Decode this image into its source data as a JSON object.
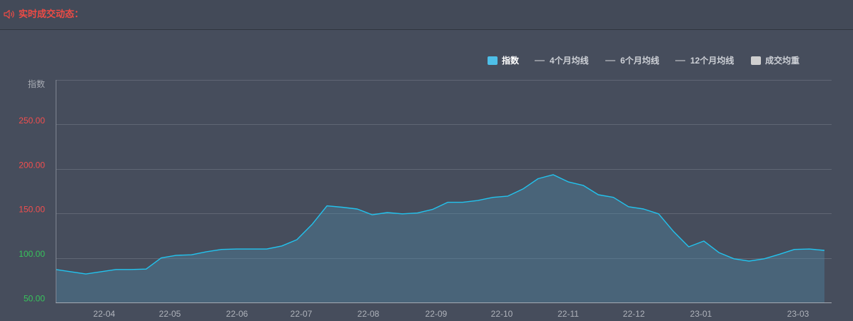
{
  "header": {
    "title": "实时成交动态：",
    "icon": "speaker-icon",
    "title_color": "#ee4b45"
  },
  "legend": {
    "position": "top-right",
    "items": [
      {
        "label": "指数",
        "symbol": "rect",
        "color": "#4ebfe8",
        "active": true
      },
      {
        "label": "4个月均线",
        "symbol": "line",
        "color": "#8e939c",
        "active": false
      },
      {
        "label": "6个月均线",
        "symbol": "line",
        "color": "#8e939c",
        "active": false
      },
      {
        "label": "12个月均线",
        "symbol": "line",
        "color": "#8e939c",
        "active": false
      },
      {
        "label": "成交均重",
        "symbol": "rect",
        "color": "#cfcfcf",
        "active": false
      }
    ]
  },
  "chart_data": {
    "type": "area",
    "ylabel": "指数",
    "ylim": [
      50,
      300
    ],
    "grid": true,
    "y_ticks": [
      {
        "label": "50.00",
        "value": 50,
        "color": "#37c35b"
      },
      {
        "label": "100.00",
        "value": 100,
        "color": "#37c35b"
      },
      {
        "label": "150.00",
        "value": 150,
        "color": "#f24e4e"
      },
      {
        "label": "200.00",
        "value": 200,
        "color": "#f24e4e"
      },
      {
        "label": "250.00",
        "value": 250,
        "color": "#f24e4e"
      }
    ],
    "x_tick_labels": [
      "22-04",
      "22-05",
      "22-06",
      "22-07",
      "22-08",
      "22-09",
      "22-10",
      "22-11",
      "22-12",
      "23-01",
      "23-03"
    ],
    "series": [
      {
        "name": "指数",
        "color": "#22c3ee",
        "fill": "rgba(80,140,170,0.37)",
        "values": [
          87.0,
          84.5,
          82.0,
          84.5,
          87.0,
          87.0,
          87.5,
          100.0,
          103.0,
          103.5,
          107.0,
          109.5,
          110.0,
          110.0,
          110.0,
          113.5,
          120.5,
          137.5,
          158.5,
          157.0,
          155.0,
          148.5,
          151.0,
          149.5,
          150.5,
          154.5,
          162.5,
          162.5,
          164.5,
          168.0,
          169.5,
          177.5,
          189.0,
          193.5,
          185.5,
          181.5,
          171.0,
          168.0,
          157.5,
          155.0,
          149.5,
          129.5,
          112.5,
          119.0,
          106.0,
          99.0,
          96.5,
          99.0,
          104.0,
          109.5,
          110.0,
          108.5
        ]
      }
    ]
  }
}
